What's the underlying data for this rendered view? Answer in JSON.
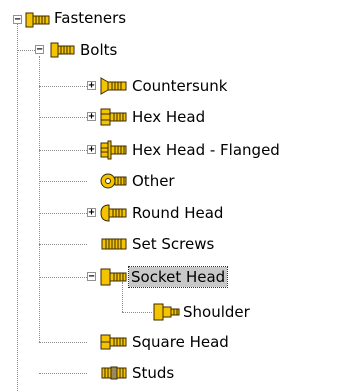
{
  "tree": {
    "root": {
      "label": "Fasteners",
      "expanded": true,
      "icon": "bolt-icon"
    },
    "bolts": {
      "label": "Bolts",
      "expanded": true,
      "icon": "bolt-icon"
    },
    "items": [
      {
        "label": "Countersunk",
        "expandable": true,
        "expanded": false,
        "icon": "countersunk-bolt-icon"
      },
      {
        "label": "Hex Head",
        "expandable": true,
        "expanded": false,
        "icon": "hex-bolt-icon"
      },
      {
        "label": "Hex Head - Flanged",
        "expandable": true,
        "expanded": false,
        "icon": "flanged-hex-bolt-icon"
      },
      {
        "label": "Other",
        "expandable": false,
        "icon": "washer-bolt-icon"
      },
      {
        "label": "Round Head",
        "expandable": true,
        "expanded": false,
        "icon": "round-head-bolt-icon"
      },
      {
        "label": "Set Screws",
        "expandable": false,
        "icon": "set-screw-icon"
      },
      {
        "label": "Socket Head",
        "expandable": true,
        "expanded": true,
        "selected": true,
        "icon": "socket-head-bolt-icon"
      },
      {
        "label": "Shoulder",
        "expandable": false,
        "child": true,
        "icon": "shoulder-bolt-icon"
      },
      {
        "label": "Square Head",
        "expandable": false,
        "icon": "square-head-bolt-icon"
      },
      {
        "label": "Studs",
        "expandable": false,
        "icon": "stud-icon"
      }
    ],
    "expand_symbol": "+",
    "collapse_symbol": "−",
    "colors": {
      "icon_fill": "#f5c400",
      "icon_stroke": "#3a2a00",
      "selection": "#c8c8c8"
    }
  }
}
